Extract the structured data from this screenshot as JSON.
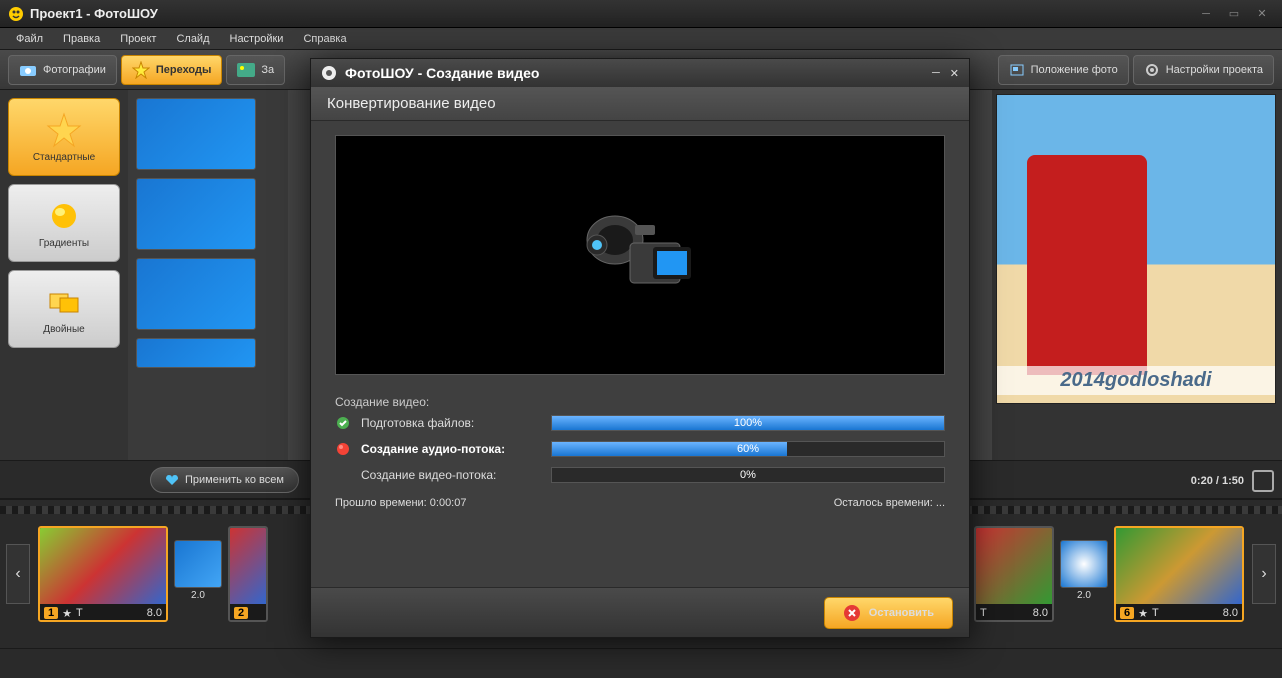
{
  "window": {
    "title": "Проект1 - ФотоШОУ"
  },
  "menu": [
    "Файл",
    "Правка",
    "Проект",
    "Слайд",
    "Настройки",
    "Справка"
  ],
  "tabs": {
    "photos": "Фотографии",
    "transitions": "Переходы",
    "backgrounds": "За"
  },
  "rightButtons": {
    "position": "Положение фото",
    "settings": "Настройки проекта"
  },
  "categories": {
    "standard": "Стандартные",
    "gradients": "Градиенты",
    "double": "Двойные"
  },
  "applyAll": "Применить ко всем",
  "watermark": "2014godloshadi",
  "playback": {
    "time": "0:20 / 1:50"
  },
  "timeline": {
    "slides": [
      {
        "num": "1",
        "dur": "8.0"
      },
      {
        "tdur": "2.0"
      },
      {
        "num": "2"
      },
      {
        "dur": "8.0"
      },
      {
        "tdur": "2.0"
      },
      {
        "num": "6",
        "dur": "8.0"
      }
    ]
  },
  "modal": {
    "title": "ФотоШОУ - Создание видео",
    "subtitle": "Конвертирование видео",
    "sectionLabel": "Создание видео:",
    "steps": [
      {
        "label": "Подготовка файлов:",
        "pct": "100%",
        "width": "100%",
        "status": "done"
      },
      {
        "label": "Создание аудио-потока:",
        "pct": "60%",
        "width": "60%",
        "status": "active"
      },
      {
        "label": "Создание видео-потока:",
        "pct": "0%",
        "width": "0%",
        "status": "pending"
      }
    ],
    "elapsed": "Прошло времени: 0:00:07",
    "remaining": "Осталось времени: ...",
    "stop": "Остановить"
  }
}
